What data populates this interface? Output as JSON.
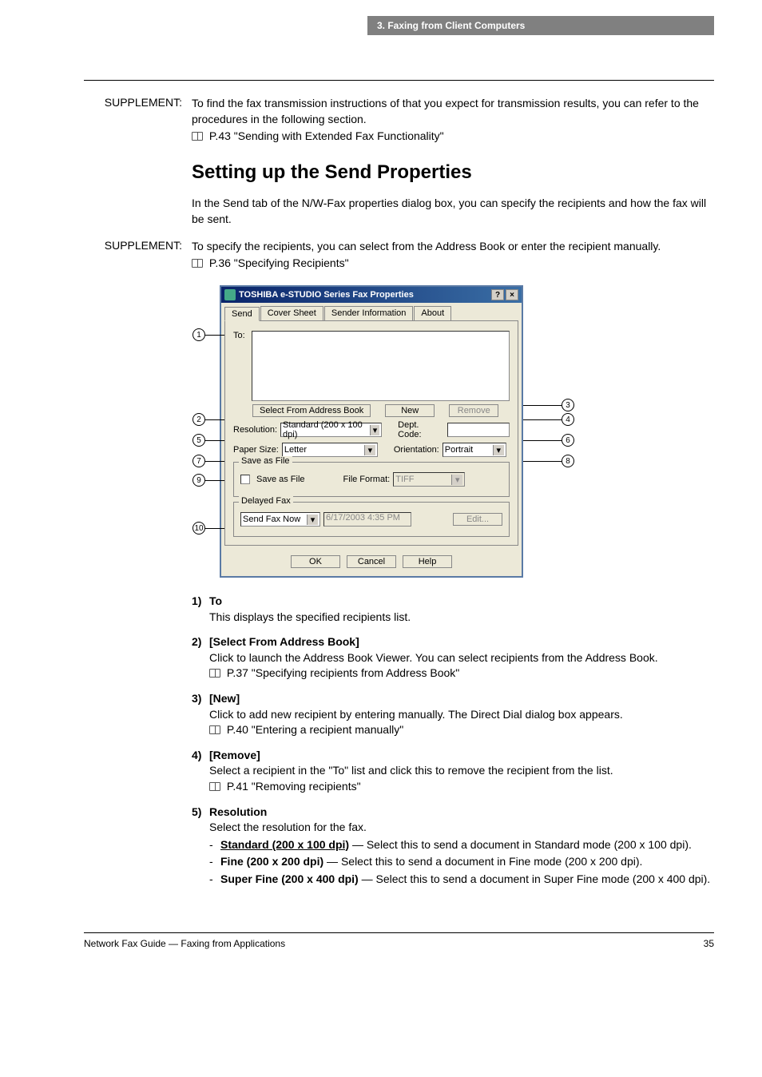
{
  "breadcrumb": "3. Faxing from Client Computers",
  "supp1": {
    "label": "SUPPLEMENT:",
    "line1": "To find the fax transmission instructions of that you expect for transmission results, you can refer to the procedures in the following section.",
    "ref": "P.43 \"Sending with Extended Fax Functionality\""
  },
  "heading": "Setting up the Send Properties",
  "intro": "In the Send tab of the N/W-Fax properties dialog box, you can specify the recipients and how the fax will be sent.",
  "supp2": {
    "label": "SUPPLEMENT:",
    "line1": "To specify the recipients, you can select from the Address Book or enter the recipient manually.",
    "ref": "P.36 \"Specifying Recipients\""
  },
  "dialog": {
    "title": "TOSHIBA e-STUDIO Series Fax Properties",
    "tabs": {
      "send": "Send",
      "cover": "Cover Sheet",
      "sender": "Sender Information",
      "about": "About"
    },
    "to_label": "To:",
    "btn_selbook": "Select From Address Book",
    "btn_new": "New",
    "btn_remove": "Remove",
    "res_label": "Resolution:",
    "res_value": "Standard (200 x 100 dpi)",
    "dept_label": "Dept. Code:",
    "paper_label": "Paper Size:",
    "paper_value": "Letter",
    "orient_label": "Orientation:",
    "orient_value": "Portrait",
    "save_group": "Save as File",
    "save_check": "Save as File",
    "ff_label": "File Format:",
    "ff_value": "TIFF",
    "delay_group": "Delayed Fax",
    "delay_value": "Send Fax Now",
    "delay_time": "6/17/2003 4:35 PM",
    "btn_edit": "Edit...",
    "btn_ok": "OK",
    "btn_cancel": "Cancel",
    "btn_help": "Help"
  },
  "callouts": {
    "c1": "1",
    "c2": "2",
    "c3": "3",
    "c4": "4",
    "c5": "5",
    "c6": "6",
    "c7": "7",
    "c8": "8",
    "c9": "9",
    "c10": "10"
  },
  "defs": {
    "d1": {
      "n": "1)",
      "t": "To",
      "b": "This displays the specified recipients list."
    },
    "d2": {
      "n": "2)",
      "t": "[Select From Address Book]",
      "b": "Click to launch the Address Book Viewer. You can select recipients from the Address Book.",
      "r": "P.37 \"Specifying recipients from Address Book\""
    },
    "d3": {
      "n": "3)",
      "t": "[New]",
      "b": "Click to add new recipient by entering manually.  The Direct Dial dialog box appears.",
      "r": "P.40 \"Entering a recipient manually\""
    },
    "d4": {
      "n": "4)",
      "t": "[Remove]",
      "b": "Select a recipient in the \"To\" list and click this to remove the recipient from the list.",
      "r": "P.41 \"Removing recipients\""
    },
    "d5": {
      "n": "5)",
      "t": "Resolution",
      "b": "Select the resolution for the fax.",
      "opts": {
        "o1a": "Standard (200 x 100 dpi)",
        "o1b": " — Select this to send a document in Standard mode (200 x 100 dpi).",
        "o2a": "Fine (200 x 200 dpi)",
        "o2b": " — Select this to send a document in Fine mode (200 x 200 dpi).",
        "o3a": "Super Fine (200 x 400 dpi)",
        "o3b": " — Select this to send a document in Super Fine mode (200 x 400 dpi)."
      }
    }
  },
  "footer": {
    "left": "Network Fax Guide — Faxing from Applications",
    "page": "35"
  }
}
